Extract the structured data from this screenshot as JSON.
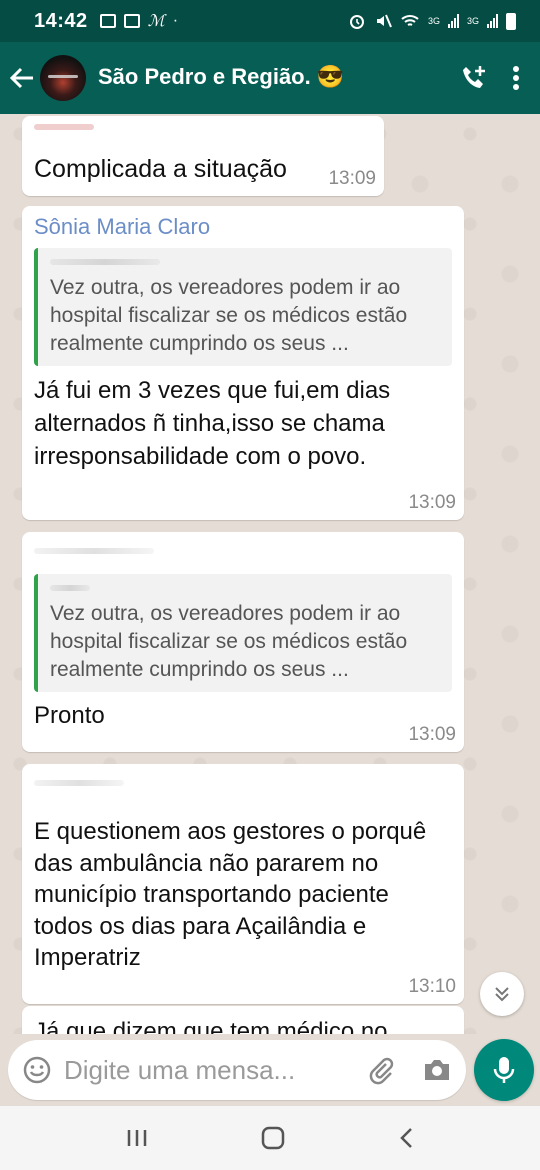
{
  "status_bar": {
    "time": "14:42",
    "carrier_mark": "ℳ",
    "dot": "·",
    "net_label_1": "3G",
    "net_label_2": "3G"
  },
  "header": {
    "group_name": "São Pedro e Região. 😎",
    "subtitle": "",
    "accent_color": "#075e54"
  },
  "messages": [
    {
      "sender": "",
      "quote": "",
      "text": "Complicada a situação",
      "time": "13:09"
    },
    {
      "sender": "Sônia Maria Claro",
      "quote": "Vez outra, os vereadores podem ir ao hospital fiscalizar se os médicos estão realmente cumprindo os seus ...",
      "text": "Já fui em 3 vezes que fui,em dias alternados ñ tinha,isso se chama irresponsabilidade  com o povo.",
      "time": "13:09"
    },
    {
      "sender": "",
      "quote": "Vez outra, os vereadores podem ir ao hospital fiscalizar se os médicos estão realmente cumprindo os seus ...",
      "text": "Pronto",
      "time": "13:09"
    },
    {
      "sender": "",
      "quote": "",
      "text": "E questionem aos gestores o porquê das ambulância não pararem no município transportando paciente todos os dias para Açailândia e Imperatriz",
      "time": "13:10"
    },
    {
      "sender": "",
      "quote": "",
      "text": "Já que dizem que tem médico no",
      "time": ""
    }
  ],
  "input": {
    "placeholder": "Digite uma mensa..."
  },
  "icons": {
    "back": "back-arrow-icon",
    "call": "add-call-icon",
    "menu": "more-vert-icon",
    "emoji": "emoji-icon",
    "attach": "paperclip-icon",
    "camera": "camera-icon",
    "mic": "mic-icon",
    "scroll": "chevron-double-down-icon"
  }
}
